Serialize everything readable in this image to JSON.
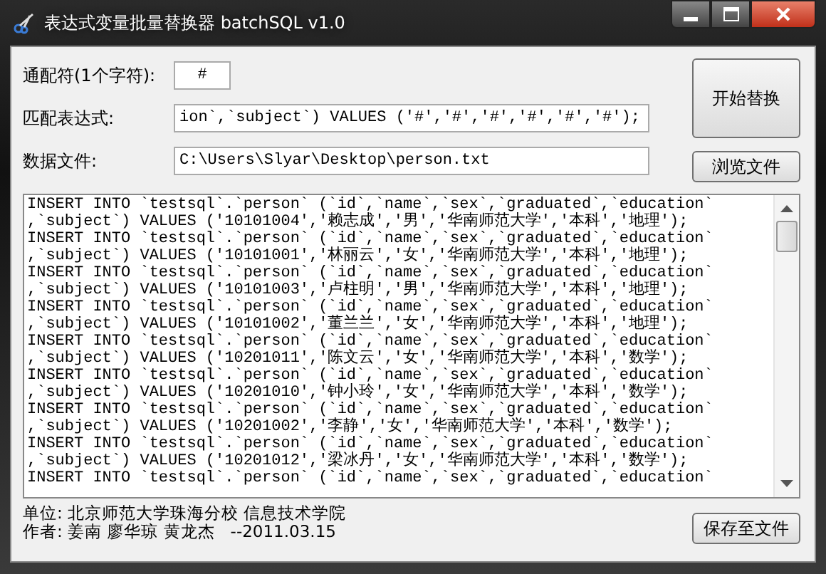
{
  "window": {
    "title": "表达式变量批量替换器 batchSQL v1.0"
  },
  "fields": [
    {
      "label": "通配符(1个字符):",
      "value": "#",
      "kind": "short"
    },
    {
      "label": "匹配表达式:",
      "value": "ion`,`subject`) VALUES ('#','#','#','#','#','#');",
      "kind": "long"
    },
    {
      "label": "数据文件:",
      "value": "C:\\Users\\Slyar\\Desktop\\person.txt",
      "kind": "long"
    }
  ],
  "buttons": {
    "start": "开始替换",
    "browse": "浏览文件",
    "save": "保存至文件"
  },
  "output_lines": [
    "INSERT INTO `testsql`.`person` (`id`,`name`,`sex`,`graduated`,`education`",
    ",`subject`) VALUES ('10101004','赖志成','男','华南师范大学','本科','地理');",
    "INSERT INTO `testsql`.`person` (`id`,`name`,`sex`,`graduated`,`education`",
    ",`subject`) VALUES ('10101001','林丽云','女','华南师范大学','本科','地理');",
    "INSERT INTO `testsql`.`person` (`id`,`name`,`sex`,`graduated`,`education`",
    ",`subject`) VALUES ('10101003','卢柱明','男','华南师范大学','本科','地理');",
    "INSERT INTO `testsql`.`person` (`id`,`name`,`sex`,`graduated`,`education`",
    ",`subject`) VALUES ('10101002','董兰兰','女','华南师范大学','本科','地理');",
    "INSERT INTO `testsql`.`person` (`id`,`name`,`sex`,`graduated`,`education`",
    ",`subject`) VALUES ('10201011','陈文云','女','华南师范大学','本科','数学');",
    "INSERT INTO `testsql`.`person` (`id`,`name`,`sex`,`graduated`,`education`",
    ",`subject`) VALUES ('10201010','钟小玲','女','华南师范大学','本科','数学');",
    "INSERT INTO `testsql`.`person` (`id`,`name`,`sex`,`graduated`,`education`",
    ",`subject`) VALUES ('10201002','李静','女','华南师范大学','本科','数学');",
    "INSERT INTO `testsql`.`person` (`id`,`name`,`sex`,`graduated`,`education`",
    ",`subject`) VALUES ('10201012','梁冰丹','女','华南师范大学','本科','数学');",
    "INSERT INTO `testsql`.`person` (`id`,`name`,`sex`,`graduated`,`education`"
  ],
  "footer": [
    "单位: 北京师范大学珠海分校 信息技术学院",
    "作者: 姜南 廖华琼 黄龙杰   --2011.03.15"
  ]
}
